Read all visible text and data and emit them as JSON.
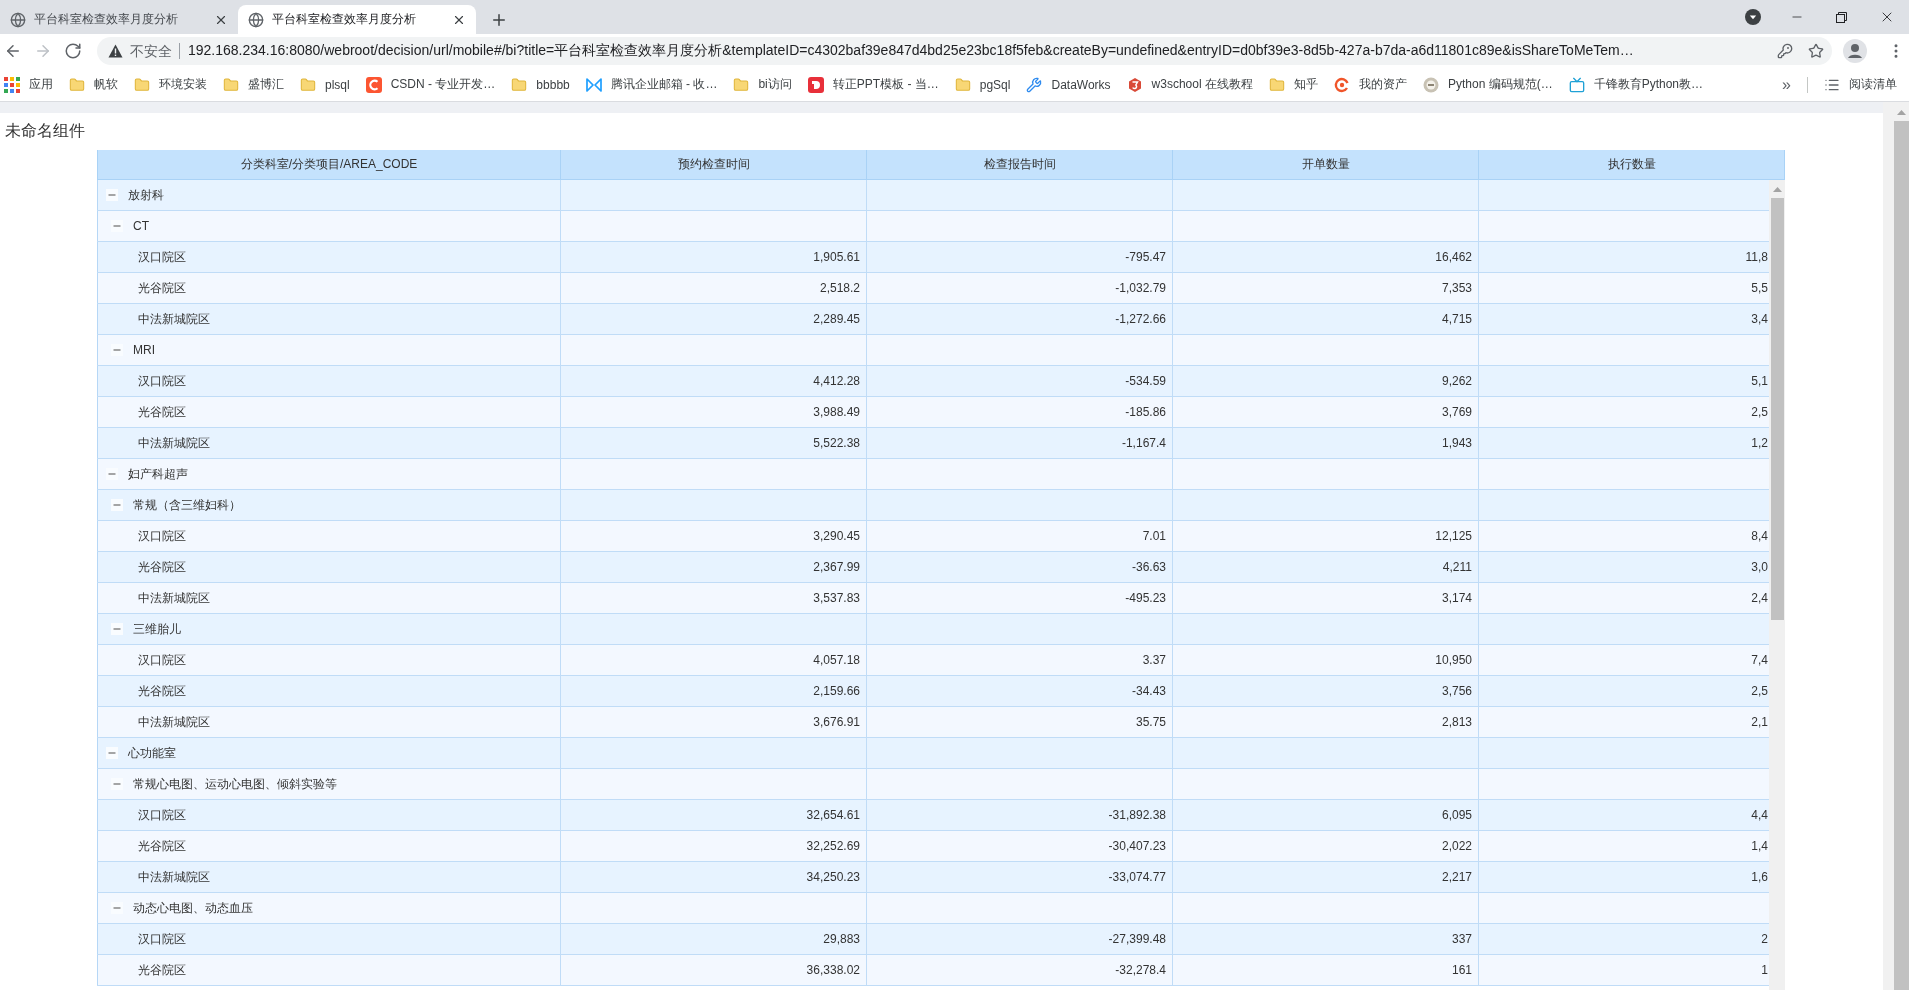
{
  "browser": {
    "tabs": [
      {
        "title": "平台科室检查效率月度分析",
        "selected": false
      },
      {
        "title": "平台科室检查效率月度分析",
        "selected": true
      }
    ],
    "navigation": [
      {
        "kind": "back",
        "disabled": false
      },
      {
        "kind": "forward",
        "disabled": true
      },
      {
        "kind": "reload",
        "disabled": false
      }
    ],
    "address_bar": {
      "security_label": "不安全",
      "url": "192.168.234.16:8080/webroot/decision/url/mobile#/bi?title=平台科室检查效率月度分析&templateID=c4302baf39e847d4bd25e23bc18f5feb&createBy=undefined&entryID=d0bf39e3-8d5b-427a-b7da-a6d11801c89e&isShareToMeTem…"
    },
    "bookmarks": [
      {
        "kind": "apps",
        "label": "应用"
      },
      {
        "kind": "folder",
        "label": "帆软"
      },
      {
        "kind": "folder",
        "label": "环境安装"
      },
      {
        "kind": "folder",
        "label": "盛博汇"
      },
      {
        "kind": "folder",
        "label": "plsql"
      },
      {
        "kind": "site",
        "label": "CSDN - 专业开发…"
      },
      {
        "kind": "folder",
        "label": "bbbbb"
      },
      {
        "kind": "site",
        "label": "腾讯企业邮箱 - 收…"
      },
      {
        "kind": "folder",
        "label": "bi访问"
      },
      {
        "kind": "site",
        "label": "转正PPT模板 - 当…"
      },
      {
        "kind": "folder",
        "label": "pgSql"
      },
      {
        "kind": "site",
        "label": "DataWorks"
      },
      {
        "kind": "site",
        "label": "w3school 在线教程"
      },
      {
        "kind": "folder",
        "label": "知乎"
      },
      {
        "kind": "site",
        "label": "我的资产"
      },
      {
        "kind": "site",
        "label": "Python 编码规范(…"
      },
      {
        "kind": "site",
        "label": "千锋教育Python教…"
      }
    ],
    "bookmarks_overflow": "»",
    "reading_list": "阅读清单"
  },
  "page": {
    "title": "未命名组件",
    "table": {
      "columns": [
        "分类科室/分类项目/AREA_CODE",
        "预约检查时间",
        "检查报告时间",
        "开单数量",
        "执行数量"
      ],
      "rows": [
        {
          "label": "放射科",
          "expanded": true,
          "children": [
            {
              "label": "CT",
              "expanded": true,
              "children": [
                {
                  "label": "汉口院区",
                  "values": [
                    "1,905.61",
                    "-795.47",
                    "16,462",
                    "11,8"
                  ]
                },
                {
                  "label": "光谷院区",
                  "values": [
                    "2,518.2",
                    "-1,032.79",
                    "7,353",
                    "5,5"
                  ]
                },
                {
                  "label": "中法新城院区",
                  "values": [
                    "2,289.45",
                    "-1,272.66",
                    "4,715",
                    "3,4"
                  ]
                }
              ]
            },
            {
              "label": "MRI",
              "expanded": true,
              "children": [
                {
                  "label": "汉口院区",
                  "values": [
                    "4,412.28",
                    "-534.59",
                    "9,262",
                    "5,1"
                  ]
                },
                {
                  "label": "光谷院区",
                  "values": [
                    "3,988.49",
                    "-185.86",
                    "3,769",
                    "2,5"
                  ]
                },
                {
                  "label": "中法新城院区",
                  "values": [
                    "5,522.38",
                    "-1,167.4",
                    "1,943",
                    "1,2"
                  ]
                }
              ]
            }
          ]
        },
        {
          "label": "妇产科超声",
          "expanded": true,
          "children": [
            {
              "label": "常规（含三维妇科）",
              "expanded": true,
              "children": [
                {
                  "label": "汉口院区",
                  "values": [
                    "3,290.45",
                    "7.01",
                    "12,125",
                    "8,4"
                  ]
                },
                {
                  "label": "光谷院区",
                  "values": [
                    "2,367.99",
                    "-36.63",
                    "4,211",
                    "3,0"
                  ]
                },
                {
                  "label": "中法新城院区",
                  "values": [
                    "3,537.83",
                    "-495.23",
                    "3,174",
                    "2,4"
                  ]
                }
              ]
            },
            {
              "label": "三维胎儿",
              "expanded": true,
              "children": [
                {
                  "label": "汉口院区",
                  "values": [
                    "4,057.18",
                    "3.37",
                    "10,950",
                    "7,4"
                  ]
                },
                {
                  "label": "光谷院区",
                  "values": [
                    "2,159.66",
                    "-34.43",
                    "3,756",
                    "2,5"
                  ]
                },
                {
                  "label": "中法新城院区",
                  "values": [
                    "3,676.91",
                    "35.75",
                    "2,813",
                    "2,1"
                  ]
                }
              ]
            }
          ]
        },
        {
          "label": "心功能室",
          "expanded": true,
          "children": [
            {
              "label": "常规心电图、运动心电图、倾斜实验等",
              "expanded": true,
              "children": [
                {
                  "label": "汉口院区",
                  "values": [
                    "32,654.61",
                    "-31,892.38",
                    "6,095",
                    "4,4"
                  ]
                },
                {
                  "label": "光谷院区",
                  "values": [
                    "32,252.69",
                    "-30,407.23",
                    "2,022",
                    "1,4"
                  ]
                },
                {
                  "label": "中法新城院区",
                  "values": [
                    "34,250.23",
                    "-33,074.77",
                    "2,217",
                    "1,6"
                  ]
                }
              ]
            },
            {
              "label": "动态心电图、动态血压",
              "expanded": true,
              "children": [
                {
                  "label": "汉口院区",
                  "values": [
                    "29,883",
                    "-27,399.48",
                    "337",
                    "2"
                  ]
                },
                {
                  "label": "光谷院区",
                  "values": [
                    "36,338.02",
                    "-32,278.4",
                    "161",
                    "1"
                  ]
                }
              ]
            }
          ]
        }
      ]
    }
  }
}
